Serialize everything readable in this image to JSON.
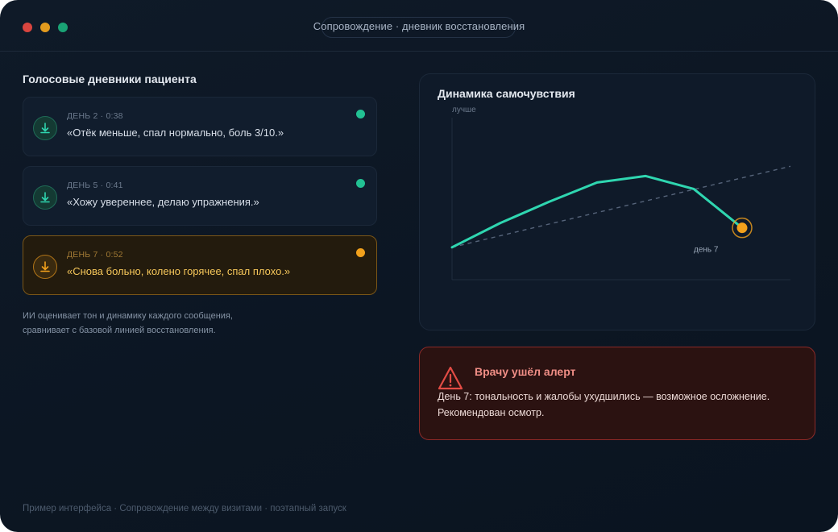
{
  "window": {
    "title": "Сопровождение · дневник восстановления",
    "controls": {
      "close_color": "#d9453f",
      "minimize_color": "#e39b1e",
      "zoom_color": "#1aa375"
    }
  },
  "diaries": {
    "heading": "Голосовые дневники пациента",
    "entries": [
      {
        "meta": "ДЕНЬ 2 · 0:38",
        "quote": "«Отёк меньше, спал нормально, боль 3/10.»",
        "status": "ok",
        "status_color": "#22c193",
        "icon": "microphone-icon"
      },
      {
        "meta": "ДЕНЬ 5 · 0:41",
        "quote": "«Хожу увереннее, делаю упражнения.»",
        "status": "ok",
        "status_color": "#22c193",
        "icon": "microphone-icon"
      },
      {
        "meta": "ДЕНЬ 7 · 0:52",
        "quote": "«Снова больно, колено горячее, спал плохо.»",
        "status": "warning",
        "status_color": "#f2a11c",
        "icon": "microphone-icon"
      }
    ],
    "note": "ИИ оценивает тон и динамику каждого сообщения, сравнивает с базовой линией восстановления."
  },
  "chart_data": {
    "type": "line",
    "title": "Динамика самочувствия",
    "ylabel": "лучше",
    "xlabel": "",
    "grid": false,
    "series": [
      {
        "role": "actual",
        "values": [
          0.2,
          0.35,
          0.48,
          0.6,
          0.64,
          0.56,
          0.32
        ],
        "color": "#2fd6b0"
      },
      {
        "role": "baseline",
        "values": [
          0.2,
          0.7
        ],
        "color": "#56647a",
        "style": "dashed"
      }
    ],
    "ylim": [
      0,
      1
    ],
    "highlight": {
      "label": "день 7",
      "color": "#f2a11c"
    }
  },
  "alert": {
    "title": "Врачу ушёл алерт",
    "body": "День 7: тональность и жалобы ухудшились — возможное осложнение. Рекомендован осмотр.",
    "icon": "warning-icon",
    "accent": "#f08e86"
  },
  "footer": {
    "text": "Пример интерфейса · Сопровождение между визитами · поэтапный запуск"
  }
}
